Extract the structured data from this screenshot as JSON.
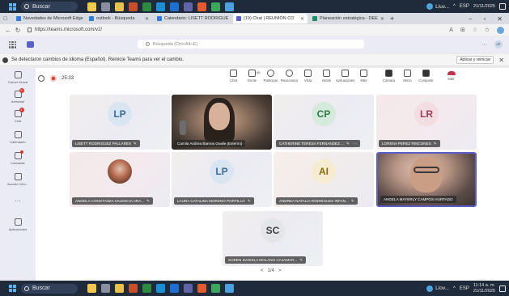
{
  "taskbar_top": {
    "search_label": "Buscar"
  },
  "taskbar_bottom": {
    "search_label": "Buscar",
    "weather": "Llov...",
    "lang": "ESP",
    "time": "11:14 a. m.",
    "date": "21/11/2025"
  },
  "taskbar_top_right": {
    "weather": "Lluv...",
    "lang": "ESP",
    "date": "21/11/2025"
  },
  "browser": {
    "tabs": [
      {
        "label": "Novedades de Microsoft Edge",
        "color": "#2f7be0",
        "active": false
      },
      {
        "label": "outlook - Búsqueda",
        "color": "#2f7be0",
        "active": false
      },
      {
        "label": "Calendario: LISETT RODRIGUE",
        "color": "#2f7be0",
        "active": false
      },
      {
        "label": "(19) Chat | REUNIÓN CO",
        "color": "#5b5fc7",
        "active": true
      },
      {
        "label": "Planeación estratégica - DEE",
        "color": "#1e8a66",
        "active": false
      }
    ],
    "new_tab": "+",
    "url": "https://teams.microsoft.com/v2/"
  },
  "teams": {
    "search_placeholder": "Búsqueda (Ctrl+Alt+E)",
    "more": "···"
  },
  "banner": {
    "message": "Se detectaron cambios de idioma (Español). Reinicie Teams para ver el cambio.",
    "button": "Aplicar y reiniciar"
  },
  "rail": [
    {
      "label": "Carnet Virtual",
      "badge": ""
    },
    {
      "label": "Actividad",
      "badge": "5"
    },
    {
      "label": "Chat",
      "badge": "1"
    },
    {
      "label": "Calendario",
      "badge": ""
    },
    {
      "label": "Llamadas",
      "badge": "dot"
    },
    {
      "label": "Avanda Virtu...",
      "badge": ""
    },
    {
      "label": "···",
      "badge": ""
    },
    {
      "label": "Aplicaciones",
      "badge": ""
    }
  ],
  "meeting": {
    "timer": "25:33",
    "controls": [
      {
        "label": "Chat",
        "icon": "chat-icon"
      },
      {
        "label": "Gente",
        "icon": "people-icon",
        "count": "86"
      },
      {
        "label": "Participar",
        "icon": "raise-hand-icon"
      },
      {
        "label": "Reaccionar",
        "icon": "react-icon"
      },
      {
        "label": "Vista",
        "icon": "view-icon"
      },
      {
        "label": "Notas",
        "icon": "notes-icon"
      },
      {
        "label": "Aplicaciones",
        "icon": "apps-icon"
      },
      {
        "label": "Más",
        "icon": "more-icon"
      },
      {
        "label": "Cámara",
        "icon": "camera-icon"
      },
      {
        "label": "Micro",
        "icon": "mic-icon"
      },
      {
        "label": "Compartir",
        "icon": "share-icon"
      },
      {
        "label": "Salir",
        "icon": "leave-icon"
      }
    ]
  },
  "participants": [
    {
      "name": "LISETT RODRIGUEZ PALLARES",
      "initials": "LP",
      "avatar_bg": "#d9e6f2",
      "avatar_fg": "#3b6b96",
      "kind": "initials"
    },
    {
      "name": "Camila Andrea Barrios Ovalle (Externo)",
      "initials": "",
      "kind": "video1"
    },
    {
      "name": "CATHERINE TERESA FERNANDEZ ...",
      "initials": "CP",
      "avatar_bg": "#d5eadc",
      "avatar_fg": "#2f7a48",
      "kind": "initials",
      "more": "···"
    },
    {
      "name": "LORENA PEREZ RINCONES",
      "initials": "LR",
      "avatar_bg": "#f3dde3",
      "avatar_fg": "#9e3c5a",
      "kind": "initials"
    },
    {
      "name": "ANGELA CONSTANZA VALENCIA ARA...",
      "initials": "",
      "kind": "avatar-photo"
    },
    {
      "name": "LAURA CATALINA MORENO PORTILLO",
      "initials": "LP",
      "avatar_bg": "#d9e6f2",
      "avatar_fg": "#3b6b96",
      "kind": "initials"
    },
    {
      "name": "ANDREA NATALIA RODRIGUEZ INFAN...",
      "initials": "AI",
      "avatar_bg": "#f5ecd2",
      "avatar_fg": "#8a6a12",
      "kind": "initials"
    },
    {
      "name": "ANGELA MAYERLY CAMPOS HURTADO",
      "initials": "",
      "kind": "video2"
    },
    {
      "name": "SOREN DANIELA MOLANO CAJAMAR...",
      "initials": "SC",
      "avatar_bg": "#e3e5e8",
      "avatar_fg": "#3a3d42",
      "kind": "initials"
    }
  ],
  "pager": {
    "prev": "<",
    "label": "1/4",
    "next": ">"
  }
}
